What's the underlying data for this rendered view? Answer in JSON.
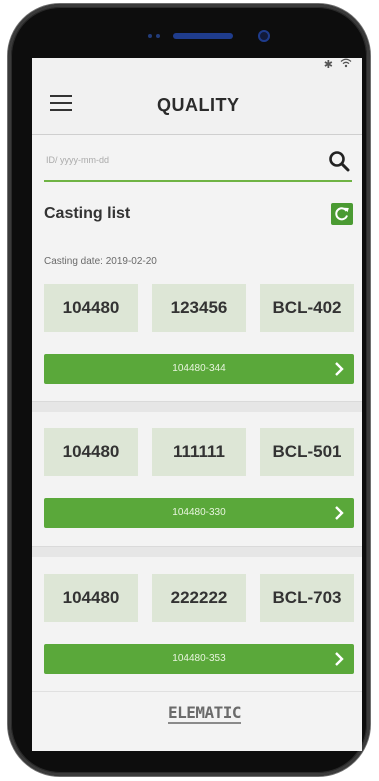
{
  "app": {
    "title": "QUALITY"
  },
  "status": {
    "bluetooth": "✱",
    "wifi": "wifi"
  },
  "search": {
    "placeholder": "ID/ yyyy-mm-dd"
  },
  "casting_list": {
    "title": "Casting list",
    "date_label": "Casting date: 2019-02-20",
    "items": [
      {
        "id": "104480",
        "code": "123456",
        "bed": "BCL-402",
        "element": "104480-344"
      },
      {
        "id": "104480",
        "code": "111111",
        "bed": "BCL-501",
        "element": "104480-330"
      },
      {
        "id": "104480",
        "code": "222222",
        "bed": "BCL-703",
        "element": "104480-353"
      }
    ]
  },
  "footer": {
    "logo": "ELEMATIC"
  },
  "colors": {
    "accent": "#5aa83a",
    "cell_bg": "#dde6d6",
    "underline": "#6fb344"
  }
}
